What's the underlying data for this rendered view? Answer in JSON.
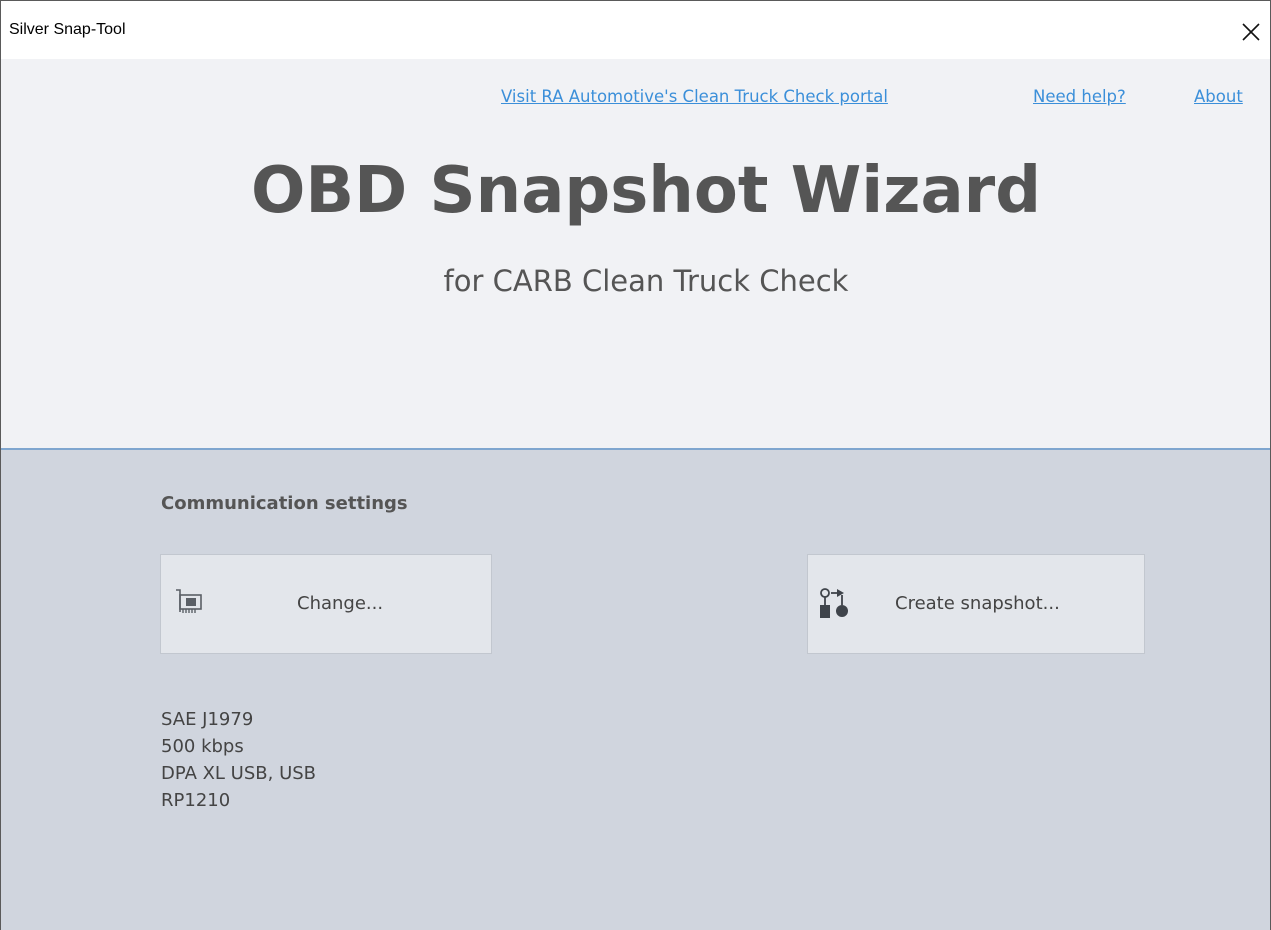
{
  "window": {
    "title": "Silver Snap-Tool",
    "close_icon": "close-icon"
  },
  "header": {
    "links": {
      "portal": "Visit RA Automotive's Clean Truck Check portal",
      "help": "Need help?",
      "about": "About"
    },
    "title": "OBD Snapshot Wizard",
    "subtitle": "for CARB Clean Truck Check"
  },
  "content": {
    "section_label": "Communication settings",
    "change_button": {
      "label": "Change...",
      "icon": "network-card-icon"
    },
    "snapshot_button": {
      "label": "Create snapshot...",
      "icon": "snapshot-flow-icon"
    },
    "settings": {
      "protocol": "SAE J1979",
      "baud_rate": "500 kbps",
      "adapter": "DPA XL USB, USB",
      "api": "RP1210"
    }
  },
  "colors": {
    "link": "#3b8fd9",
    "header_bg": "#f1f2f5",
    "content_bg": "#d0d5de",
    "divider": "#7fa6cf",
    "button_bg": "#e3e6eb"
  }
}
